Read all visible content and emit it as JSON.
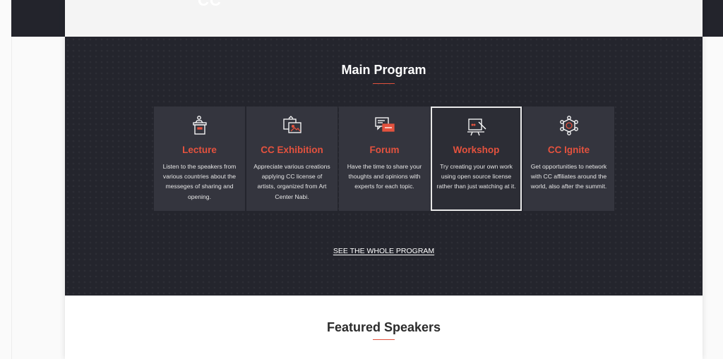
{
  "header": {
    "logo_fragment": "CC"
  },
  "main_program": {
    "title": "Main Program",
    "cards": [
      {
        "title": "Lecture",
        "icon": "podium-icon",
        "description": "Listen to the speakers from various countries about the messeges of sharing and opening."
      },
      {
        "title": "CC Exhibition",
        "icon": "exhibition-frames-icon",
        "description": "Appreciate various creations applying CC license of artists, organized from Art Center Nabi."
      },
      {
        "title": "Forum",
        "icon": "chat-bubbles-icon",
        "description": "Have the time to share your thoughts and opinions with experts for each topic."
      },
      {
        "title": "Workshop",
        "icon": "easel-brush-icon",
        "description": "Try creating your own work using open source license rather than just watching at it."
      },
      {
        "title": "CC Ignite",
        "icon": "network-icon",
        "description": "Get opportunities to network with CC affiliates around the world, also after the summit."
      }
    ],
    "see_all_label": "SEE THE WHOLE PROGRAM"
  },
  "featured_speakers": {
    "title": "Featured Speakers"
  },
  "colors": {
    "accent": "#e4523e",
    "dark_bg": "#24252d",
    "card_bg": "#34353e"
  }
}
